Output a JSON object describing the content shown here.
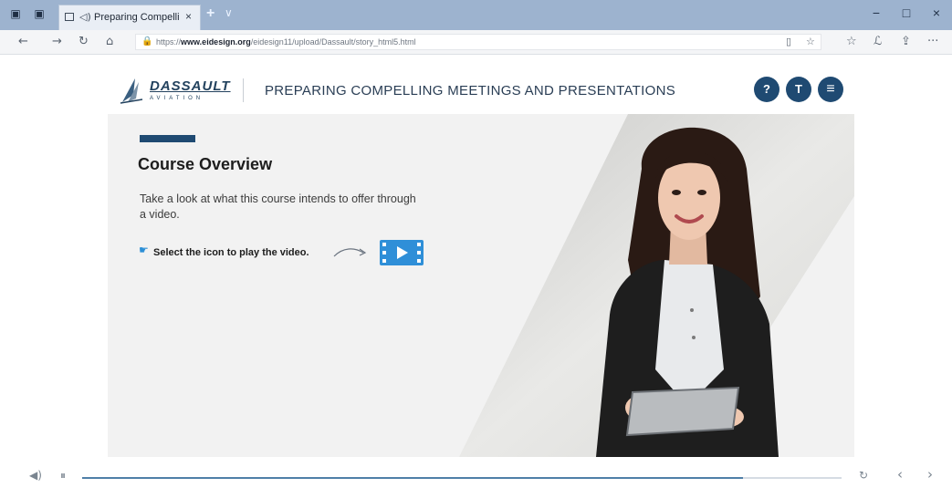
{
  "browser": {
    "tab": {
      "title": "Preparing Compelli",
      "close_glyph": "×",
      "audio_glyph": "◁)",
      "icon": "page-icon"
    },
    "new_tab_glyph": "+",
    "tab_menu_glyph": "∨",
    "window_controls": {
      "minimize": "−",
      "maximize": "□",
      "close": "×"
    },
    "nav": {
      "back": "←",
      "forward": "→",
      "refresh": "↻",
      "home": "⌂"
    },
    "url": {
      "prefix": "https://",
      "host": "www.eidesign.org",
      "path": "/eidesign11/upload/Dassault/story_html5.html",
      "lock_glyph": "🔒",
      "reading_view_glyph": "▯",
      "favorite_glyph": "☆"
    },
    "toolbar": {
      "favorites": "☆",
      "pen": "ℒ",
      "share": "⇪",
      "more": "···"
    },
    "colors": {
      "titlebar": "#9db3cf"
    }
  },
  "course": {
    "logo": {
      "word": "DASSAULT",
      "sub": "AVIATION"
    },
    "title": "PREPARING COMPELLING MEETINGS AND PRESENTATIONS",
    "buttons": {
      "help": "?",
      "transcript": "T",
      "menu": "≡"
    },
    "colors": {
      "primary": "#1f4a72",
      "play": "#2f8fd8"
    }
  },
  "slide": {
    "heading": "Course Overview",
    "description": "Take a look at what this course intends to offer through a video.",
    "instruction": "Select the icon to play the video.",
    "play_icon": "video-play-icon",
    "photo": "businesswoman-holding-tablet"
  },
  "player": {
    "volume_glyph": "◀)",
    "pause_glyph": "⏸",
    "progress": 0.87,
    "replay_glyph": "↻",
    "prev_glyph": "‹",
    "next_glyph": "›"
  }
}
